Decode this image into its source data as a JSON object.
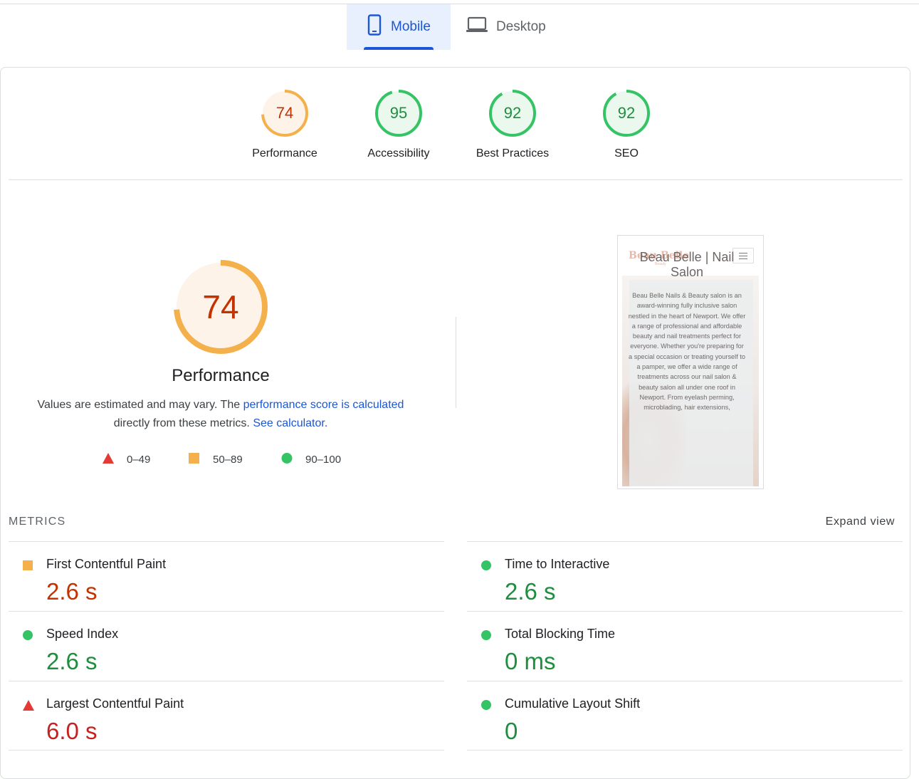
{
  "colors": {
    "accent": "#1a56d6",
    "fail": "#e53935",
    "average": "#f4b04a",
    "pass": "#34c466",
    "average_text": "#c33300",
    "pass_text": "#1e8e3e"
  },
  "tabs": [
    {
      "label": "Mobile",
      "icon": "smartphone-icon",
      "active": true
    },
    {
      "label": "Desktop",
      "icon": "laptop-icon",
      "active": false
    }
  ],
  "categories": [
    {
      "score": "74",
      "label": "Performance",
      "status": "average"
    },
    {
      "score": "95",
      "label": "Accessibility",
      "status": "pass"
    },
    {
      "score": "92",
      "label": "Best Practices",
      "status": "pass"
    },
    {
      "score": "92",
      "label": "SEO",
      "status": "pass"
    }
  ],
  "performance": {
    "score": "74",
    "title": "Performance",
    "desc_prefix": "Values are estimated and may vary. The ",
    "desc_link": "performance score is calculated",
    "desc_middle": " directly from these metrics. ",
    "calc_link": "See calculator.",
    "legend": [
      {
        "icon": "triangle-icon",
        "range": "0–49"
      },
      {
        "icon": "square-icon",
        "range": "50–89"
      },
      {
        "icon": "circle-icon",
        "range": "90–100"
      }
    ]
  },
  "screenshot": {
    "logo": "Beau Belle",
    "logo_sub": "Beauty",
    "title": "Beau Belle | Nail Salon",
    "body": "Beau Belle Nails & Beauty salon is an award-winning fully inclusive salon nestled in the heart of Newport. We offer a range of professional and affordable beauty and nail treatments perfect for everyone. Whether you're preparing for a special occasion or treating yourself to a pamper, we offer a wide range of treatments across our nail salon & beauty salon all under one roof in Newport. From eyelash perming, microblading, hair extensions,"
  },
  "metrics": {
    "heading": "METRICS",
    "expand_label": "Expand view",
    "items": [
      {
        "label": "First Contentful Paint",
        "value": "2.6 s",
        "status": "average"
      },
      {
        "label": "Time to Interactive",
        "value": "2.6 s",
        "status": "pass"
      },
      {
        "label": "Speed Index",
        "value": "2.6 s",
        "status": "pass"
      },
      {
        "label": "Total Blocking Time",
        "value": "0 ms",
        "status": "pass"
      },
      {
        "label": "Largest Contentful Paint",
        "value": "6.0 s",
        "status": "fail"
      },
      {
        "label": "Cumulative Layout Shift",
        "value": "0",
        "status": "pass"
      }
    ]
  }
}
